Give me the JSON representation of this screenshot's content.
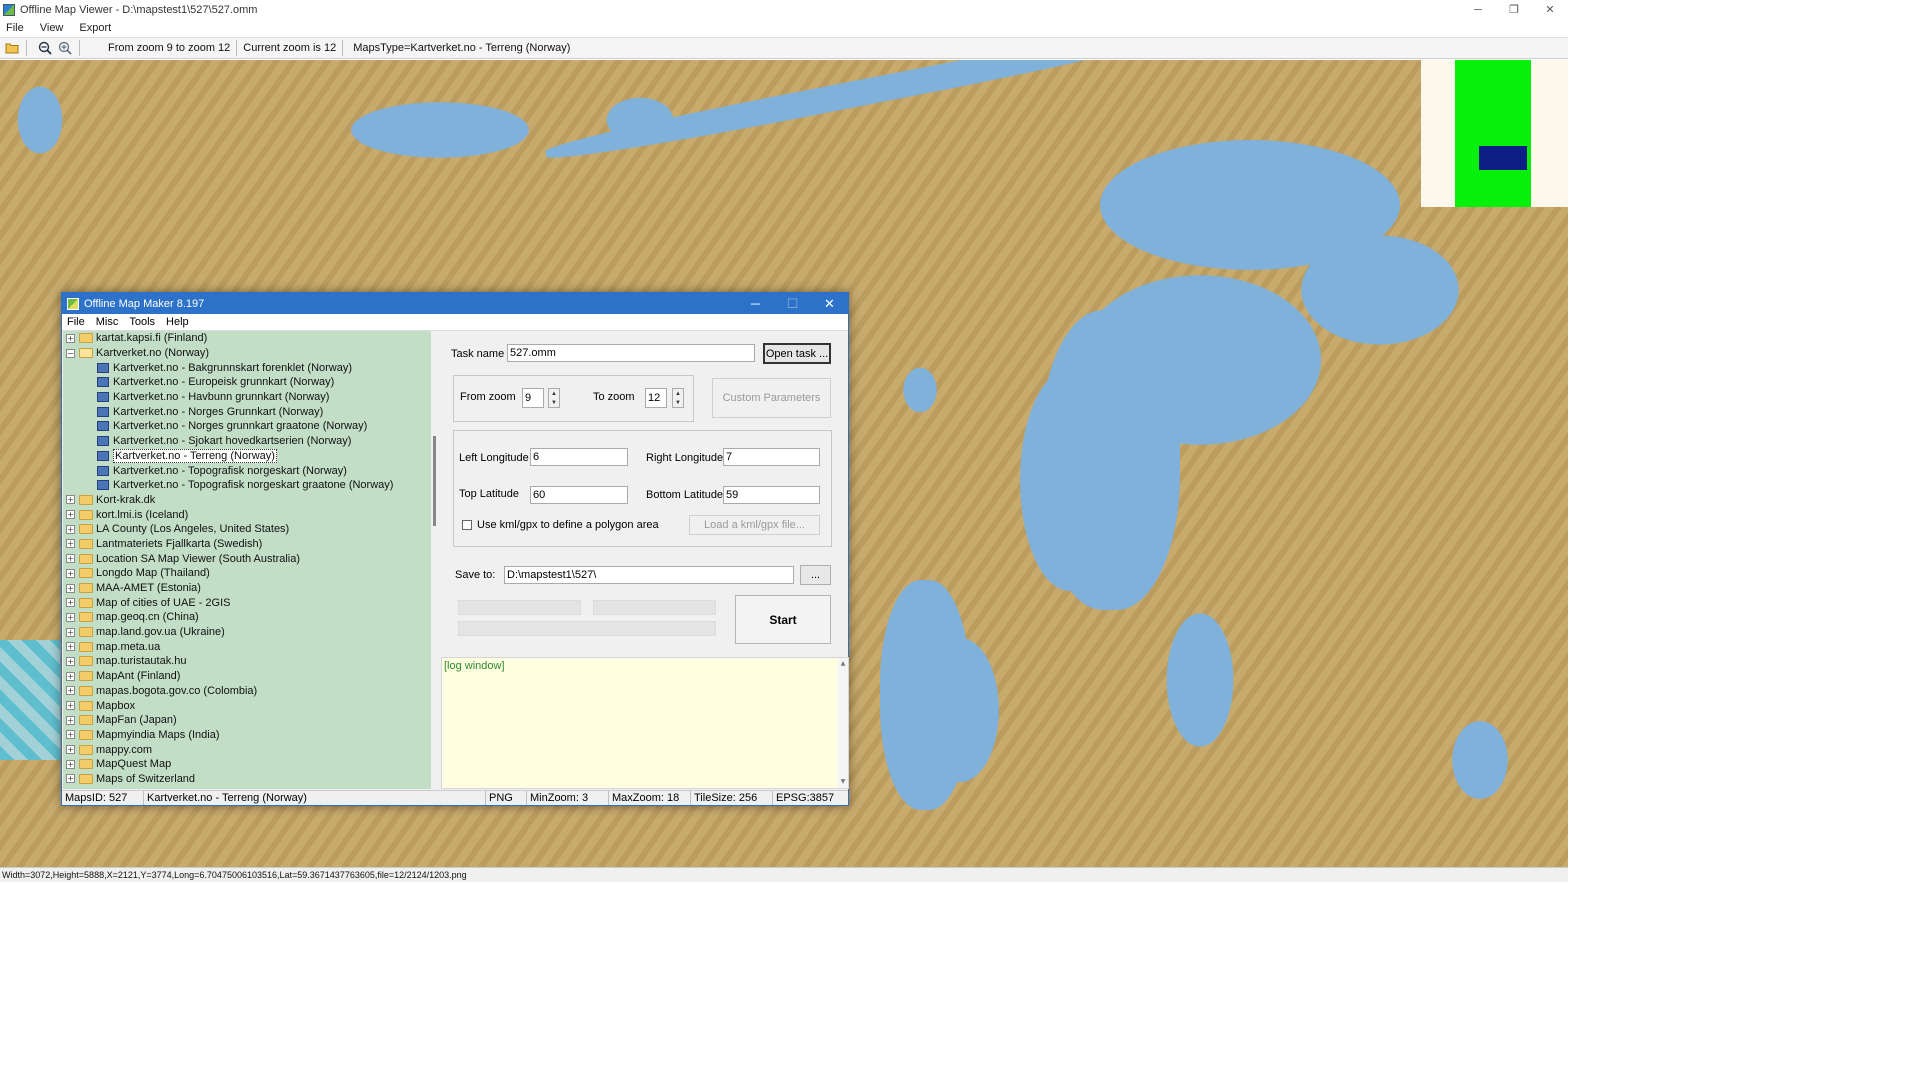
{
  "window": {
    "title": "Offline Map Viewer - D:\\mapstest1\\527\\527.omm",
    "controls": {
      "minimize": "─",
      "restore": "❐",
      "close": "✕"
    }
  },
  "menubar": [
    "File",
    "View",
    "Export"
  ],
  "toolbar": {
    "zoom_range": "From zoom 9 to zoom 12",
    "current_zoom": "Current zoom is 12",
    "maps_type": "MapsType=Kartverket.no - Terreng (Norway)"
  },
  "map": {
    "colors": {
      "land": "#c3a465",
      "water": "#7fb1da"
    },
    "minimap_colors": {
      "background": "#fdf8ec",
      "coverage": "#06f00a",
      "viewport": "#0b1f86"
    }
  },
  "statusbar": {
    "text": "Width=3072,Height=5888,X=2121,Y=3774,Long=6.70475006103516,Lat=59.3671437763605,file=12/2124/1203.png"
  },
  "dialog": {
    "title": "Offline Map Maker 8.197",
    "controls": {
      "minimize": "─",
      "maximize": "☐",
      "close": "✕"
    },
    "menu": [
      "File",
      "Misc",
      "Tools",
      "Help"
    ],
    "tree": [
      {
        "label": "kartat.kapsi.fi (Finland)",
        "type": "folder",
        "expanded": false
      },
      {
        "label": "Kartverket.no (Norway)",
        "type": "folder",
        "expanded": true
      },
      {
        "label": "Kartverket.no - Bakgrunnskart forenklet (Norway)",
        "type": "map"
      },
      {
        "label": "Kartverket.no - Europeisk grunnkart (Norway)",
        "type": "map"
      },
      {
        "label": "Kartverket.no - Havbunn grunnkart (Norway)",
        "type": "map"
      },
      {
        "label": "Kartverket.no - Norges Grunnkart (Norway)",
        "type": "map"
      },
      {
        "label": "Kartverket.no - Norges grunnkart graatone (Norway)",
        "type": "map"
      },
      {
        "label": "Kartverket.no - Sjokart hovedkartserien (Norway)",
        "type": "map"
      },
      {
        "label": "Kartverket.no - Terreng (Norway)",
        "type": "map",
        "selected": true
      },
      {
        "label": "Kartverket.no - Topografisk norgeskart (Norway)",
        "type": "map"
      },
      {
        "label": "Kartverket.no - Topografisk norgeskart graatone (Norway)",
        "type": "map"
      },
      {
        "label": "Kort-krak.dk",
        "type": "folder",
        "expanded": false
      },
      {
        "label": "kort.lmi.is (Iceland)",
        "type": "folder",
        "expanded": false
      },
      {
        "label": "LA County (Los Angeles, United States)",
        "type": "folder",
        "expanded": false
      },
      {
        "label": "Lantmateriets Fjallkarta (Swedish)",
        "type": "folder",
        "expanded": false
      },
      {
        "label": "Location SA Map Viewer (South Australia)",
        "type": "folder",
        "expanded": false
      },
      {
        "label": "Longdo Map (Thailand)",
        "type": "folder",
        "expanded": false
      },
      {
        "label": "MAA-AMET (Estonia)",
        "type": "folder",
        "expanded": false
      },
      {
        "label": "Map of cities of UAE - 2GIS",
        "type": "folder",
        "expanded": false
      },
      {
        "label": "map.geoq.cn (China)",
        "type": "folder",
        "expanded": false
      },
      {
        "label": "map.land.gov.ua (Ukraine)",
        "type": "folder",
        "expanded": false
      },
      {
        "label": "map.meta.ua",
        "type": "folder",
        "expanded": false
      },
      {
        "label": "map.turistautak.hu",
        "type": "folder",
        "expanded": false
      },
      {
        "label": "MapAnt (Finland)",
        "type": "folder",
        "expanded": false
      },
      {
        "label": "mapas.bogota.gov.co (Colombia)",
        "type": "folder",
        "expanded": false
      },
      {
        "label": "Mapbox",
        "type": "folder",
        "expanded": false
      },
      {
        "label": "MapFan (Japan)",
        "type": "folder",
        "expanded": false
      },
      {
        "label": "Mapmyindia Maps (India)",
        "type": "folder",
        "expanded": false
      },
      {
        "label": "mappy.com",
        "type": "folder",
        "expanded": false
      },
      {
        "label": "MapQuest Map",
        "type": "folder",
        "expanded": false
      },
      {
        "label": "Maps of Switzerland",
        "type": "folder",
        "expanded": false
      }
    ],
    "form": {
      "task_name_label": "Task name",
      "task_name_value": "527.omm",
      "open_task_button": "Open task ...",
      "from_zoom_label": "From zoom",
      "from_zoom_value": "9",
      "to_zoom_label": "To zoom",
      "to_zoom_value": "12",
      "custom_parameters_button": "Custom Parameters",
      "left_longitude_label": "Left Longitude",
      "left_longitude_value": "6",
      "right_longitude_label": "Right Longitude",
      "right_longitude_value": "7",
      "top_latitude_label": "Top Latitude",
      "top_latitude_value": "60",
      "bottom_latitude_label": "Bottom Latitude",
      "bottom_latitude_value": "59",
      "kml_checkbox_label": "Use kml/gpx to define a polygon area",
      "kml_checked": false,
      "load_kml_button": "Load a kml/gpx file...",
      "save_to_label": "Save to:",
      "save_to_value": "D:\\mapstest1\\527\\",
      "browse_button": "...",
      "start_button": "Start"
    },
    "log": {
      "text": "[log window]"
    },
    "status": {
      "maps_id": "MapsID: 527",
      "map_name": "Kartverket.no - Terreng (Norway)",
      "format": "PNG",
      "min_zoom": "MinZoom: 3",
      "max_zoom": "MaxZoom: 18",
      "tile_size": "TileSize: 256",
      "epsg": "EPSG:3857"
    }
  }
}
